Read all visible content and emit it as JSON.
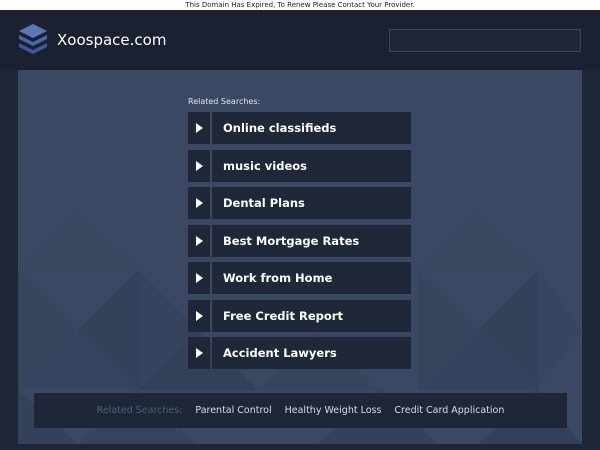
{
  "notice": "This Domain Has Expired, To Renew Please Contact Your Provider.",
  "header": {
    "site_name": "Xoospace.com",
    "search_value": "",
    "logo_icon": "stacked-layers-icon"
  },
  "main": {
    "related_label": "Related Searches:",
    "links": [
      {
        "label": "Online classifieds"
      },
      {
        "label": "music videos"
      },
      {
        "label": "Dental Plans"
      },
      {
        "label": "Best Mortgage Rates"
      },
      {
        "label": "Work from Home"
      },
      {
        "label": "Free Credit Report"
      },
      {
        "label": "Accident Lawyers"
      }
    ]
  },
  "footer": {
    "label": "Related Searches:",
    "links": [
      {
        "label": "Parental Control"
      },
      {
        "label": "Healthy Weight Loss"
      },
      {
        "label": "Credit Card Application"
      }
    ]
  },
  "colors": {
    "page_bg": "#1f2636",
    "panel_bg": "#3a4863",
    "link_bg": "#1f2738",
    "logo_accent": "#4a67a8"
  }
}
